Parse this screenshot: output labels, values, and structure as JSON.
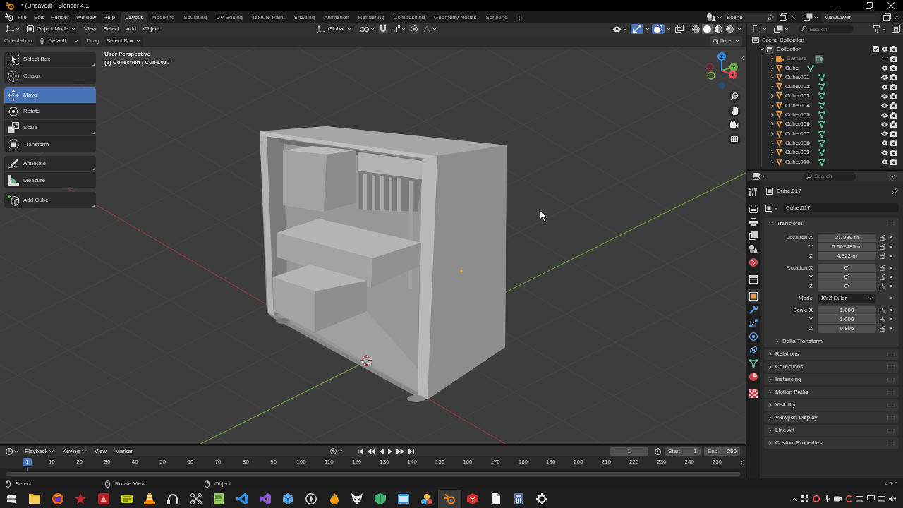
{
  "window": {
    "title": "* (Unsaved) - Blender 4.1"
  },
  "topbar": {
    "menus": [
      "File",
      "Edit",
      "Render",
      "Window",
      "Help"
    ],
    "workspaces": [
      {
        "label": "Layout",
        "selected": true
      },
      {
        "label": "Modeling",
        "selected": false
      },
      {
        "label": "Sculpting",
        "selected": false
      },
      {
        "label": "UV Editing",
        "selected": false
      },
      {
        "label": "Texture Paint",
        "selected": false
      },
      {
        "label": "Shading",
        "selected": false
      },
      {
        "label": "Animation",
        "selected": false
      },
      {
        "label": "Rendering",
        "selected": false
      },
      {
        "label": "Compositing",
        "selected": false
      },
      {
        "label": "Geometry Nodes",
        "selected": false
      },
      {
        "label": "Scripting",
        "selected": false
      }
    ],
    "add_workspace": "+",
    "scene": "Scene",
    "view_layer": "ViewLayer"
  },
  "viewport_header": {
    "mode": "Object Mode",
    "menus": [
      "View",
      "Select",
      "Add",
      "Object"
    ],
    "orientation": "Global",
    "gizmos": {
      "on": true
    },
    "overlays": {
      "on": true
    },
    "xray": {
      "on": false
    },
    "shading": [
      {
        "selected": false
      },
      {
        "selected": true
      },
      {
        "selected": false
      },
      {
        "selected": false
      }
    ]
  },
  "tool_settings": {
    "orientation_label": "Orientation:",
    "orientation": "Default",
    "drag_label": "Drag:",
    "drag": "Select Box",
    "options": "Options"
  },
  "toolbar": [
    {
      "tools": [
        {
          "label": "Select Box",
          "selected": false,
          "variants": true
        },
        {
          "label": "Cursor",
          "selected": false,
          "variants": false
        }
      ]
    },
    {
      "tools": [
        {
          "label": "Move",
          "selected": true,
          "variants": false
        },
        {
          "label": "Rotate",
          "selected": false,
          "variants": false
        },
        {
          "label": "Scale",
          "selected": false,
          "variants": true
        },
        {
          "label": "Transform",
          "selected": false,
          "variants": false
        }
      ]
    },
    {
      "tools": [
        {
          "label": "Annotate",
          "selected": false,
          "variants": true
        },
        {
          "label": "Measure",
          "selected": false,
          "variants": false
        }
      ]
    },
    {
      "tools": [
        {
          "label": "Add Cube",
          "selected": false,
          "variants": true
        }
      ]
    }
  ],
  "viewport": {
    "view_name": "User Perspective",
    "context": "(1) Collection | Cube.017",
    "gizmo_axes": [
      "Z",
      "Y",
      "X"
    ]
  },
  "outliner": {
    "search": {
      "placeholder": "Search"
    },
    "tree": [
      {
        "kind": "scene_collection",
        "label": "Scene Collection",
        "children": [
          {
            "kind": "collection",
            "label": "Collection",
            "expanded": true,
            "checked": true,
            "visible": true,
            "children": [
              {
                "kind": "camera",
                "label": "Camera",
                "expanded": false,
                "visible": false
              },
              {
                "kind": "mesh",
                "label": "Cube",
                "expanded": false,
                "visible": true
              },
              {
                "kind": "mesh",
                "label": "Cube.001",
                "expanded": false,
                "visible": true
              },
              {
                "kind": "mesh",
                "label": "Cube.002",
                "expanded": false,
                "visible": true
              },
              {
                "kind": "mesh",
                "label": "Cube.003",
                "expanded": false,
                "visible": true
              },
              {
                "kind": "mesh",
                "label": "Cube.004",
                "expanded": false,
                "visible": true
              },
              {
                "kind": "mesh",
                "label": "Cube.005",
                "expanded": false,
                "visible": true
              },
              {
                "kind": "mesh",
                "label": "Cube.006",
                "expanded": false,
                "visible": true
              },
              {
                "kind": "mesh",
                "label": "Cube.007",
                "expanded": false,
                "visible": true
              },
              {
                "kind": "mesh",
                "label": "Cube.008",
                "expanded": false,
                "visible": true
              },
              {
                "kind": "mesh",
                "label": "Cube.009",
                "expanded": false,
                "visible": true
              },
              {
                "kind": "mesh",
                "label": "Cube.010",
                "expanded": false,
                "visible": true
              }
            ]
          }
        ]
      }
    ]
  },
  "properties": {
    "search": {
      "placeholder": "Search"
    },
    "tab_groups": [
      [
        {
          "selected": false
        }
      ],
      [
        {
          "selected": false
        },
        {
          "selected": false
        },
        {
          "selected": false
        },
        {
          "selected": false
        },
        {
          "selected": false
        }
      ],
      [
        {
          "selected": false
        }
      ],
      [
        {
          "selected": true
        },
        {
          "selected": false
        },
        {
          "selected": false
        },
        {
          "selected": false
        },
        {
          "selected": false
        },
        {
          "selected": false
        },
        {
          "selected": false
        }
      ],
      [
        {
          "selected": false
        }
      ]
    ],
    "object": "Cube.017",
    "object_name": "Cube.017",
    "panels": [
      {
        "title": "Transform",
        "expanded": true,
        "groups": [
          {
            "rows": [
              {
                "kind": "number",
                "label": "Location X",
                "value": "3.7989 m"
              },
              {
                "kind": "number",
                "label": "Y",
                "value": "0.002485 m"
              },
              {
                "kind": "number",
                "label": "Z",
                "value": "4.322 m"
              }
            ]
          },
          {
            "rows": [
              {
                "kind": "number",
                "label": "Rotation X",
                "value": "0°"
              },
              {
                "kind": "number",
                "label": "Y",
                "value": "0°"
              },
              {
                "kind": "number",
                "label": "Z",
                "value": "0°"
              }
            ]
          },
          {
            "rows": [
              {
                "kind": "dropdown",
                "label": "Mode",
                "value": "XYZ Euler"
              }
            ]
          },
          {
            "rows": [
              {
                "kind": "number",
                "label": "Scale X",
                "value": "1.000"
              },
              {
                "kind": "number",
                "label": "Y",
                "value": "1.000"
              },
              {
                "kind": "number",
                "label": "Z",
                "value": "0.906"
              }
            ]
          }
        ],
        "subpanels": [
          {
            "title": "Delta Transform",
            "expanded": false
          }
        ]
      },
      {
        "title": "Relations",
        "expanded": false
      },
      {
        "title": "Collections",
        "expanded": false
      },
      {
        "title": "Instancing",
        "expanded": false
      },
      {
        "title": "Motion Paths",
        "expanded": false
      },
      {
        "title": "Visibility",
        "expanded": false
      },
      {
        "title": "Viewport Display",
        "expanded": false
      },
      {
        "title": "Line Art",
        "expanded": false
      },
      {
        "title": "Custom Properties",
        "expanded": false
      }
    ]
  },
  "timeline": {
    "menus": [
      {
        "label": "Playback",
        "kind": "popover"
      },
      {
        "label": "Keying",
        "kind": "popover"
      },
      {
        "label": "View",
        "kind": "menu"
      },
      {
        "label": "Marker",
        "kind": "menu"
      }
    ],
    "current_frame": "1",
    "start_label": "Start",
    "start": "1",
    "end_label": "End",
    "end": "250",
    "ruler": {
      "current": "1",
      "labels": [
        "10",
        "20",
        "30",
        "40",
        "50",
        "60",
        "70",
        "80",
        "90",
        "100",
        "110",
        "120",
        "130",
        "140",
        "150",
        "160",
        "170",
        "180",
        "190",
        "200",
        "210",
        "220",
        "230",
        "240",
        "250"
      ]
    }
  },
  "status_bar": {
    "items": [
      "Select",
      "Rotate View",
      "Object"
    ],
    "version": "4.1.0"
  },
  "taskbar": {
    "apps": [
      {
        "selected": false
      },
      {
        "selected": false
      },
      {
        "selected": false
      },
      {
        "selected": false
      },
      {
        "selected": false
      },
      {
        "selected": false
      },
      {
        "selected": false
      },
      {
        "selected": false
      },
      {
        "selected": false
      },
      {
        "selected": false
      },
      {
        "selected": false
      },
      {
        "selected": false
      },
      {
        "selected": false
      },
      {
        "selected": false
      },
      {
        "selected": false
      },
      {
        "selected": false
      },
      {
        "selected": false
      },
      {
        "selected": false
      },
      {
        "selected": true
      },
      {
        "selected": false
      },
      {
        "selected": false
      },
      {
        "selected": false
      },
      {
        "selected": false
      }
    ]
  }
}
